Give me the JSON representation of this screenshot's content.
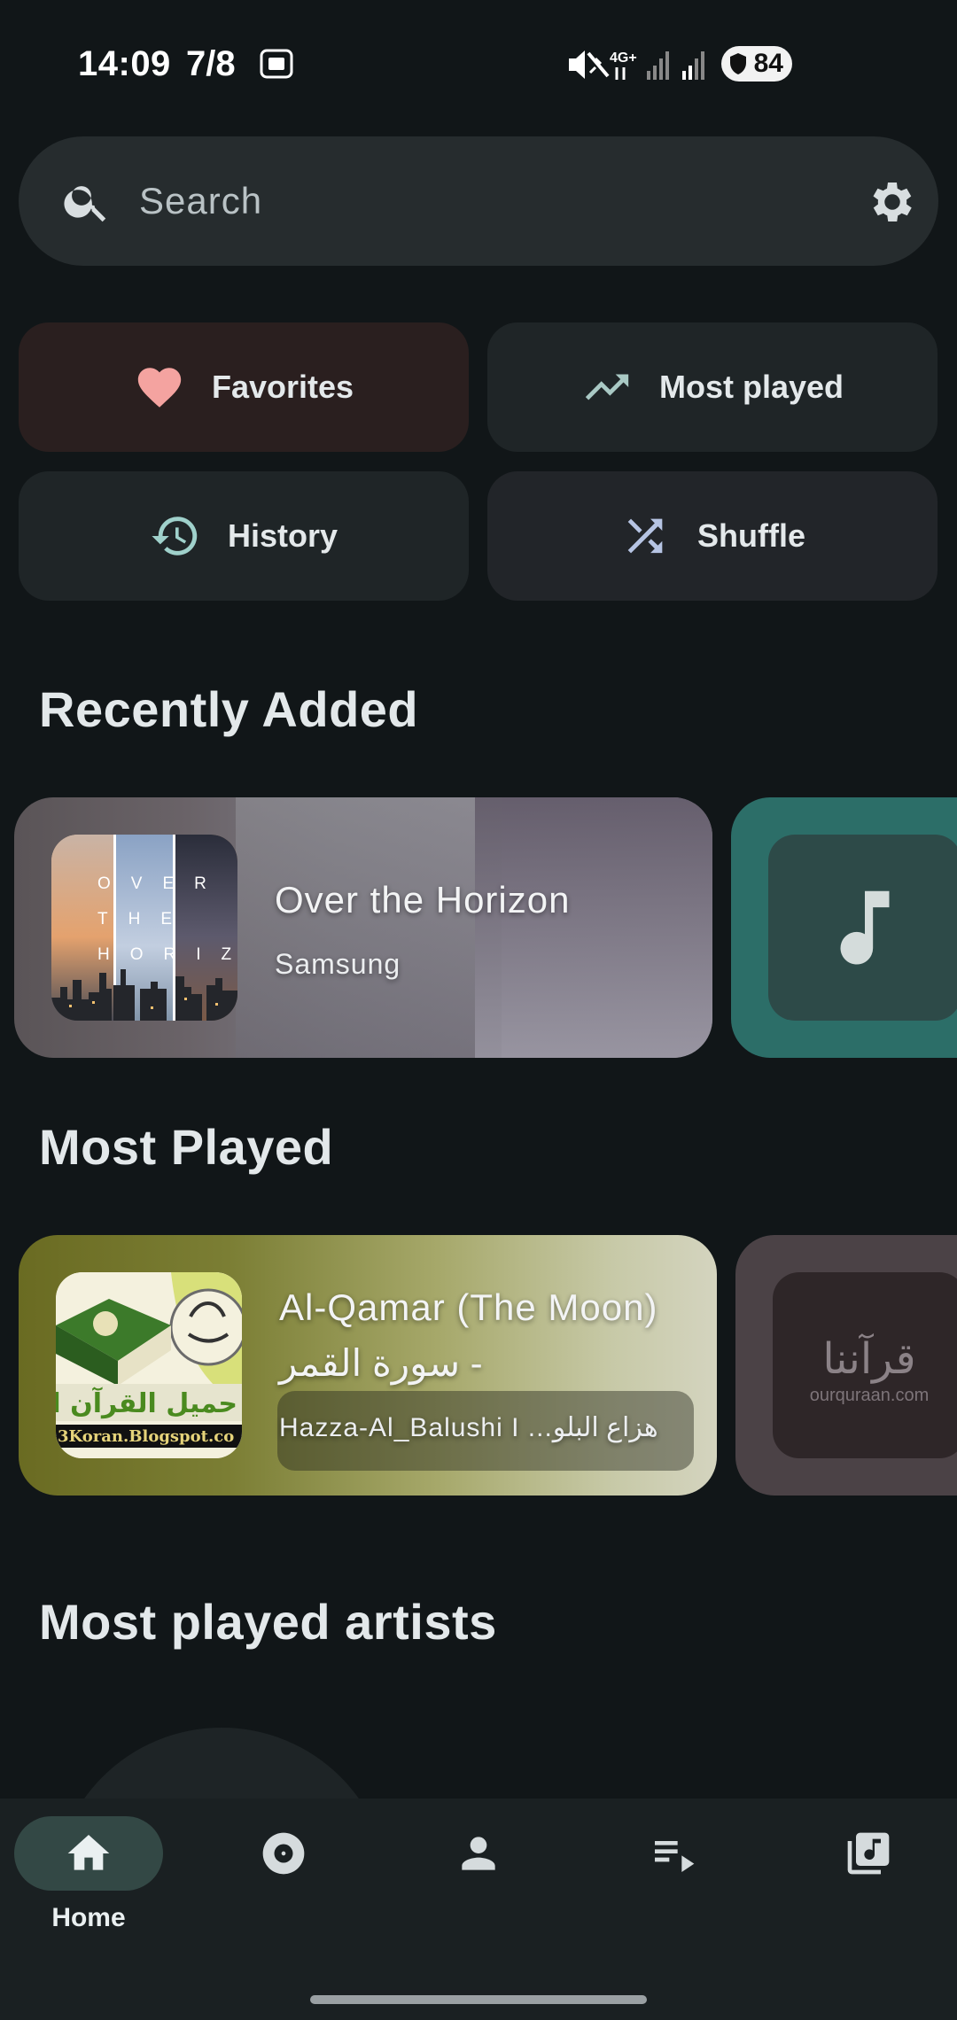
{
  "status_bar": {
    "time": "14:09",
    "date": "7/8",
    "network": "4G+",
    "battery": "84"
  },
  "search": {
    "placeholder": "Search"
  },
  "quick_actions": {
    "favorites": "Favorites",
    "most_played": "Most played",
    "history": "History",
    "shuffle": "Shuffle"
  },
  "sections": {
    "recently_added": "Recently Added",
    "most_played": "Most Played",
    "most_played_artists": "Most played artists"
  },
  "recently_added": [
    {
      "title": "Over the Horizon",
      "artist": "Samsung",
      "art_text": "OVER THE HORIZON"
    }
  ],
  "most_played": [
    {
      "title_line1": "Al-Qamar (The Moon)",
      "title_line2": "- سورة القمر",
      "artist": "Hazza-Al_Balushi I ...هزاع البلو",
      "art_text_main": "حميل القرآن الكري",
      "art_text_url": "3Koran.Blogspot.co"
    },
    {
      "art_text_ar": "قرآننا",
      "art_text_en": "ourquraan.com"
    }
  ],
  "bottom_nav": {
    "home": "Home"
  },
  "colors": {
    "background": "#111618",
    "favorites_chip": "#2a1f1f",
    "heart": "#f4a3a0",
    "accent_teal": "#2c6e68",
    "active_nav": "#334845"
  },
  "icons": [
    "search-icon",
    "settings-icon",
    "heart-icon",
    "trending-up-icon",
    "history-icon",
    "shuffle-icon",
    "music-note-icon",
    "home-icon",
    "album-icon",
    "person-icon",
    "playlist-icon",
    "library-music-icon"
  ]
}
